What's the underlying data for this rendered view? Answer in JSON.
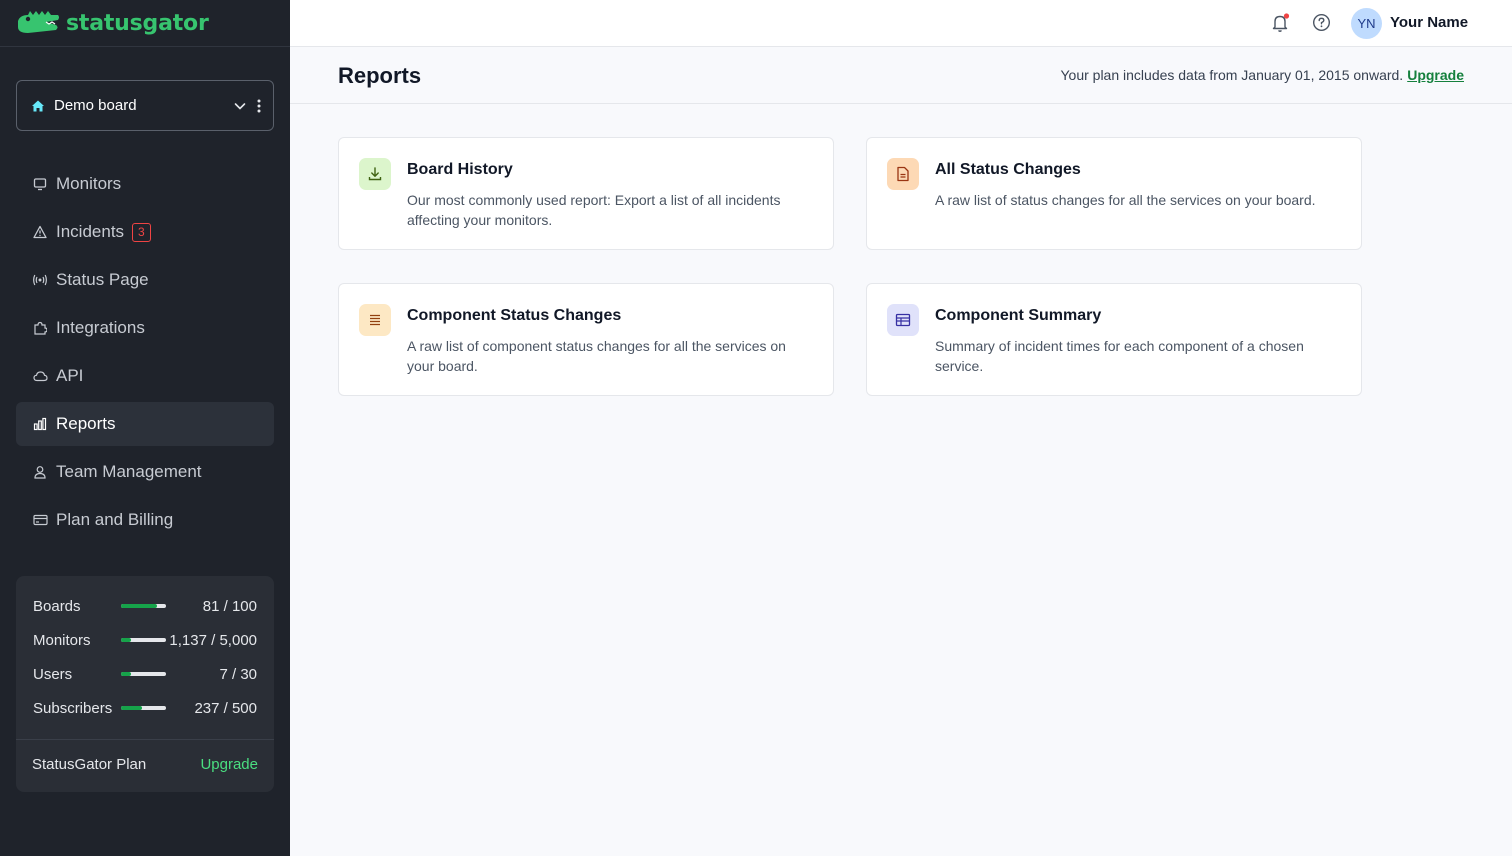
{
  "brand": {
    "name": "statusgator"
  },
  "board": {
    "name": "Demo board"
  },
  "nav": {
    "items": [
      {
        "label": "Monitors"
      },
      {
        "label": "Incidents",
        "badge": "3"
      },
      {
        "label": "Status Page"
      },
      {
        "label": "Integrations"
      },
      {
        "label": "API"
      },
      {
        "label": "Reports"
      },
      {
        "label": "Team Management"
      },
      {
        "label": "Plan and Billing"
      }
    ],
    "active": "Reports"
  },
  "usage": {
    "rows": [
      {
        "label": "Boards",
        "value": "81 / 100",
        "fraction": 0.81
      },
      {
        "label": "Monitors",
        "value": "1,137 / 5,000",
        "fraction": 0.23
      },
      {
        "label": "Users",
        "value": "7 / 30",
        "fraction": 0.23
      },
      {
        "label": "Subscribers",
        "value": "237 / 500",
        "fraction": 0.47
      }
    ],
    "plan_name": "StatusGator Plan",
    "upgrade_label": "Upgrade"
  },
  "user": {
    "initials": "YN",
    "name": "Your Name"
  },
  "page": {
    "title": "Reports",
    "plan_note": "Your plan includes data from January 01, 2015 onward.",
    "upgrade_link": "Upgrade"
  },
  "reports": [
    {
      "title": "Board History",
      "description": "Our most commonly used report: Export a list of all incidents affecting your monitors.",
      "icon": "download-icon",
      "color": "#dcf5cc"
    },
    {
      "title": "All Status Changes",
      "description": "A raw list of status changes for all the services on your board.",
      "icon": "document-icon",
      "color": "#fdd9b5"
    },
    {
      "title": "Component Status Changes",
      "description": "A raw list of component status changes for all the services on your board.",
      "icon": "list-icon",
      "color": "#fde8c4"
    },
    {
      "title": "Component Summary",
      "description": "Summary of incident times for each component of a chosen service.",
      "icon": "table-icon",
      "color": "#e0e2fa"
    }
  ],
  "colors": {
    "accent": "#16a34a",
    "brand": "#37c46f",
    "sidebar": "#1f232b",
    "badge": "#ef4444"
  }
}
